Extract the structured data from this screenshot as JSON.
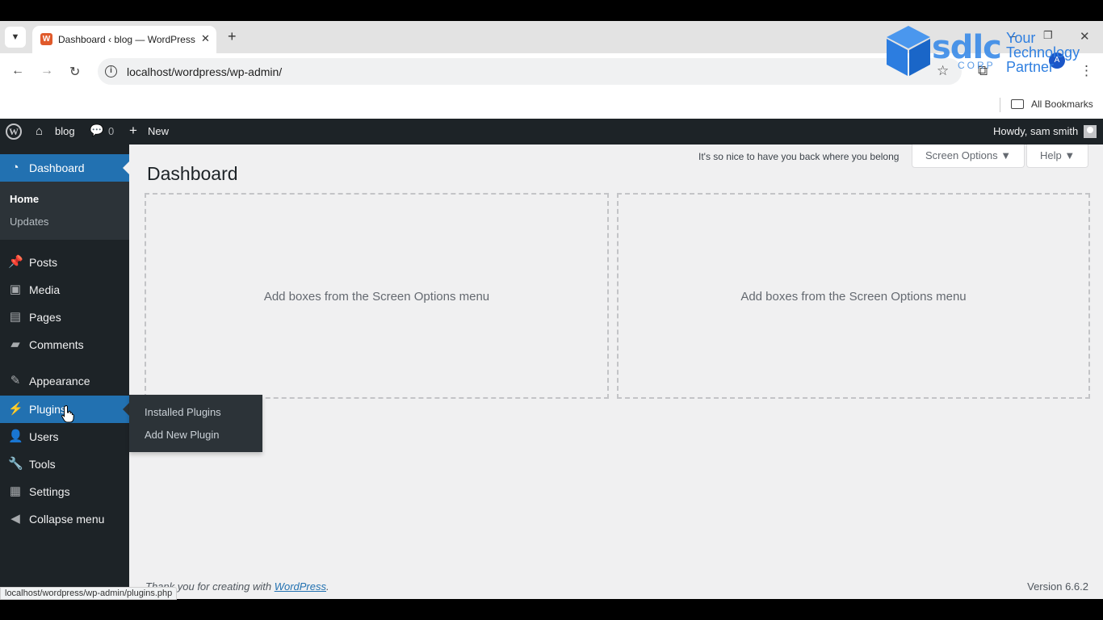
{
  "browser": {
    "tab_title": "Dashboard ‹ blog — WordPress",
    "tab_close": "✕",
    "new_tab": "+",
    "url": "localhost/wordpress/wp-admin/",
    "profile_initial": "A",
    "bookmarks_label": "All Bookmarks",
    "status_url": "localhost/wordpress/wp-admin/plugins.php"
  },
  "watermark": {
    "brand": "sdlc",
    "corp": "CORP",
    "tagline": "Your Technology Partner"
  },
  "admin_bar": {
    "site_name": "blog",
    "comments_count": "0",
    "new_label": "New",
    "greeting": "Howdy, sam smith"
  },
  "sidebar": {
    "dashboard": "Dashboard",
    "submenu": {
      "home": "Home",
      "updates": "Updates"
    },
    "items": [
      {
        "label": "Posts",
        "icon": "pushpin-icon"
      },
      {
        "label": "Media",
        "icon": "media-icon"
      },
      {
        "label": "Pages",
        "icon": "pages-icon"
      },
      {
        "label": "Comments",
        "icon": "comment-icon"
      },
      {
        "label": "Appearance",
        "icon": "brush-icon"
      },
      {
        "label": "Plugins",
        "icon": "plug-icon"
      },
      {
        "label": "Users",
        "icon": "user-icon"
      },
      {
        "label": "Tools",
        "icon": "wrench-icon"
      },
      {
        "label": "Settings",
        "icon": "settings-icon"
      },
      {
        "label": "Collapse menu",
        "icon": "collapse-icon"
      }
    ],
    "plugins_flyout": [
      "Installed Plugins",
      "Add New Plugin"
    ]
  },
  "main": {
    "welcome_text": "It's so nice to have you back where you belong",
    "screen_options": "Screen Options ▼",
    "help": "Help ▼",
    "title": "Dashboard",
    "empty_box_message": "Add boxes from the Screen Options menu",
    "footer_prefix": "Thank you for creating with ",
    "footer_link": "WordPress",
    "footer_suffix": ".",
    "version": "Version 6.6.2"
  },
  "colors": {
    "admin_bar_bg": "#1d2327",
    "active_menu": "#2271b1",
    "content_bg": "#f0f0f1"
  }
}
